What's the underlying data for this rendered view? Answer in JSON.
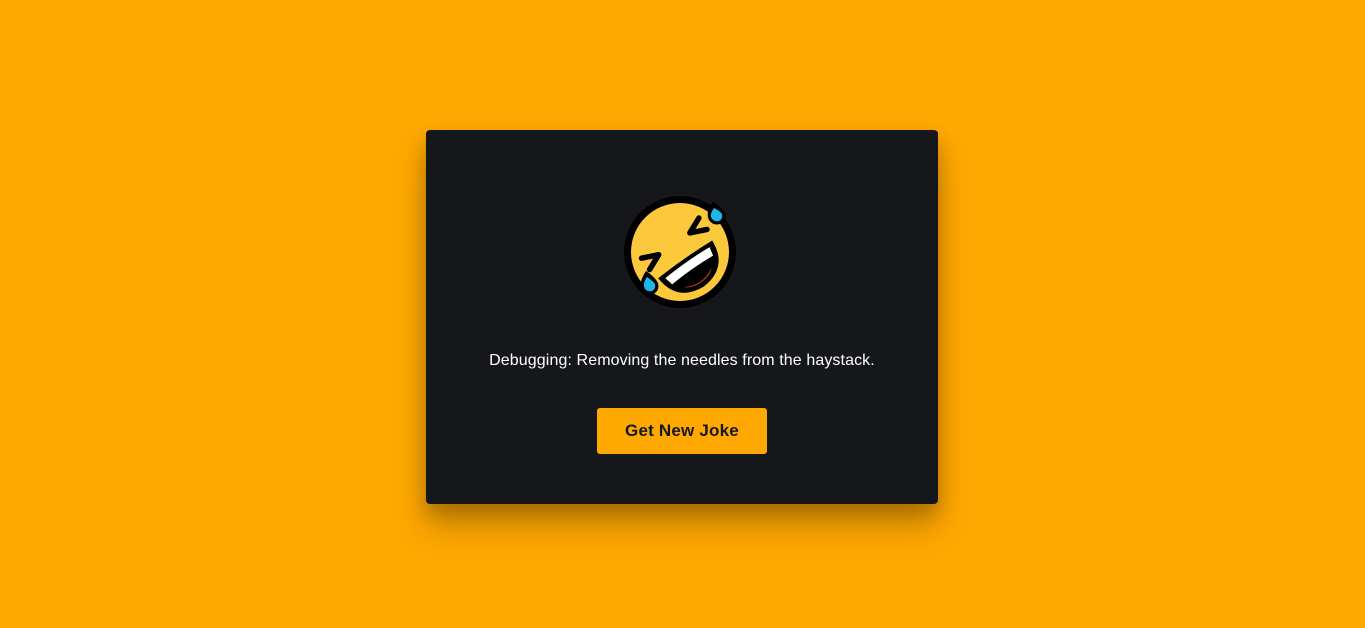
{
  "card": {
    "icon": "rolling-on-floor-laughing-icon",
    "joke_text": "Debugging: Removing the needles from the haystack.",
    "button_label": "Get New Joke"
  },
  "colors": {
    "page_background": "#FFA800",
    "card_background": "#15171B",
    "button_background": "#FFA800",
    "button_text": "#15171B",
    "joke_text": "#FFFFFF",
    "emoji_face": "#FCC93D",
    "emoji_tears": "#1DB6EA",
    "emoji_tongue": "#E0361E"
  }
}
